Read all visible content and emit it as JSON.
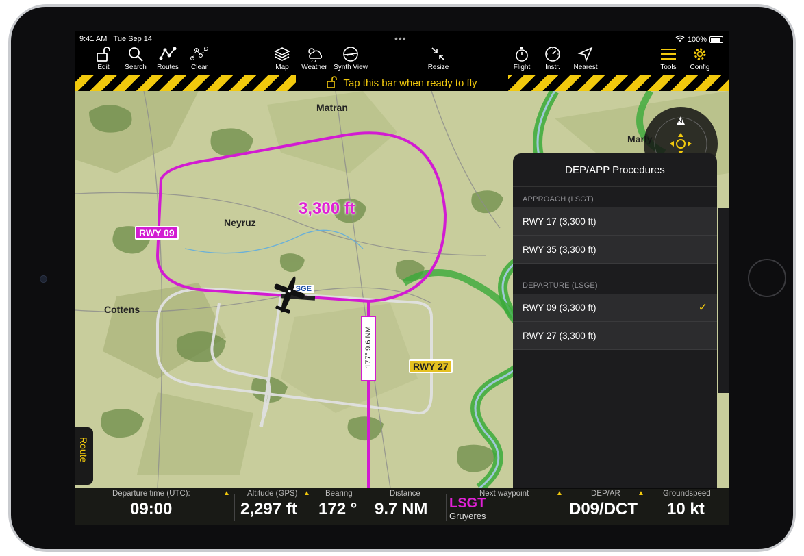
{
  "status": {
    "time": "9:41 AM",
    "date": "Tue Sep 14",
    "battery": "100%"
  },
  "toolbar": {
    "edit": "Edit",
    "search": "Search",
    "routes": "Routes",
    "clear": "Clear",
    "map": "Map",
    "weather": "Weather",
    "synth_view": "Synth View",
    "resize": "Resize",
    "flight": "Flight",
    "instr": "Instr.",
    "nearest": "Nearest",
    "tools": "Tools",
    "config": "Config"
  },
  "fly_bar": {
    "message": "Tap this bar when ready to fly"
  },
  "map": {
    "places": {
      "matran": "Matran",
      "neyruz": "Neyruz",
      "cottens": "Cottens",
      "marly": "Marly"
    },
    "altitude_label": "3,300 ft",
    "runway_labels": {
      "rwy09": "RWY 09",
      "rwy27": "RWY 27"
    },
    "airport_tag": "LSGE",
    "leg_label": "177° 9.6 NM",
    "colors": {
      "route": "#d21bd2",
      "pattern": "#d8d8d8",
      "water": "#3aaa3a"
    }
  },
  "panel": {
    "title": "DEP/APP Procedures",
    "approach_header": "APPROACH (LSGT)",
    "approach": [
      {
        "label": "RWY 17 (3,300 ft)"
      },
      {
        "label": "RWY 35 (3,300 ft)"
      }
    ],
    "departure_header": "DEPARTURE (LSGE)",
    "departure": [
      {
        "label": "RWY 09 (3,300 ft)",
        "selected": true
      },
      {
        "label": "RWY 27 (3,300 ft)",
        "selected": false
      }
    ],
    "check": "✓"
  },
  "side_tabs": {
    "route": "Route"
  },
  "instruments": {
    "departure_time": {
      "label": "Departure time (UTC):",
      "value": "09:00"
    },
    "altitude": {
      "label": "Altitude (GPS)",
      "value": "2,297 ft"
    },
    "bearing": {
      "label": "Bearing",
      "value": "172 °"
    },
    "distance": {
      "label": "Distance",
      "value": "9.7 NM"
    },
    "next_waypoint": {
      "label": "Next waypoint",
      "value": "LSGT",
      "sub": "Gruyeres"
    },
    "dep_arr": {
      "label": "DEP/AR",
      "value": "D09/DCT"
    },
    "groundspeed": {
      "label": "Groundspeed",
      "value": "10 kt"
    }
  }
}
